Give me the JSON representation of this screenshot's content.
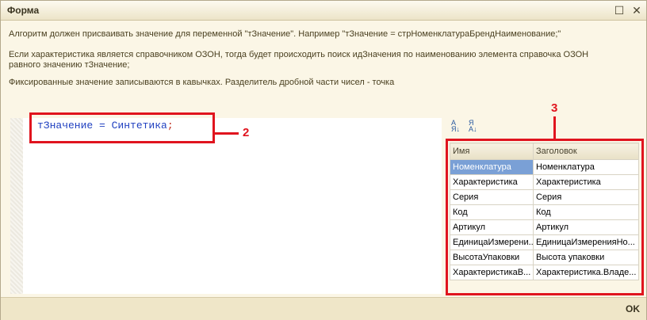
{
  "window": {
    "title": "Форма",
    "maximize_glyph": "☐",
    "close_glyph": "✕"
  },
  "description": {
    "line1": "Алгоритм должен присваивать значение для переменной \"тЗначение\". Например \"тЗначение = стрНоменклатураБрендНаименование;\"",
    "line2a": "Если характеристика является справочником ОЗОН, тогда будет происходить поиск идЗначения по наименованию элемента справочка ОЗОН",
    "line2b": "равного значению тЗначение;",
    "line3": "Фиксированные значение записываются в кавычках. Разделитель дробной части чисел - точка"
  },
  "editor": {
    "code_main": "тЗначение = Синтетика",
    "code_semi": ";"
  },
  "callouts": {
    "editor": "2",
    "table": "3"
  },
  "table": {
    "headers": [
      "Имя",
      "Заголовок"
    ],
    "rows": [
      [
        "Номенклатура",
        "Номенклатура"
      ],
      [
        "Характеристика",
        "Характеристика"
      ],
      [
        "Серия",
        "Серия"
      ],
      [
        "Код",
        "Код"
      ],
      [
        "Артикул",
        "Артикул"
      ],
      [
        "ЕдиницаИзмерени...",
        "ЕдиницаИзмеренияНо..."
      ],
      [
        "ВысотаУпаковки",
        "Высота упаковки"
      ],
      [
        "ХарактеристикаВ...",
        "Характеристика.Владе..."
      ]
    ]
  },
  "sort_icons": [
    "sort-az-icon",
    "sort-za-icon"
  ],
  "footer": {
    "ok_label": "OK"
  },
  "colors": {
    "accent_red": "#e0141e",
    "selection": "#7aa0d6",
    "code_blue": "#2040c0"
  }
}
